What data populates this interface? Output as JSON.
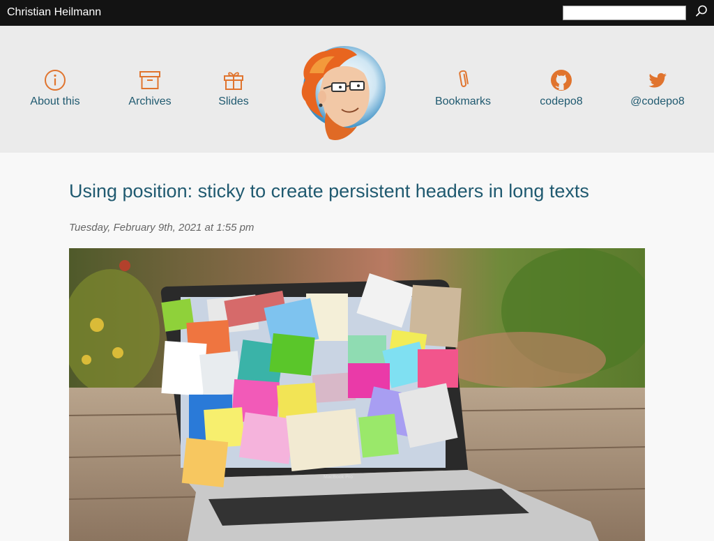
{
  "topbar": {
    "site_title": "Christian Heilmann",
    "search": {
      "value": "",
      "placeholder": ""
    }
  },
  "nav": {
    "left": [
      {
        "label": "About this",
        "icon": "info-icon"
      },
      {
        "label": "Archives",
        "icon": "archive-box-icon"
      },
      {
        "label": "Slides",
        "icon": "gift-icon"
      }
    ],
    "right": [
      {
        "label": "Bookmarks",
        "icon": "paperclip-icon"
      },
      {
        "label": "codepo8",
        "icon": "github-icon"
      },
      {
        "label": "@codepo8",
        "icon": "twitter-icon"
      }
    ]
  },
  "post": {
    "title": "Using position: sticky to create persistent headers in long texts",
    "date": "Tuesday, February 9th, 2021 at 1:55 pm",
    "hero_laptop_brand": "MacBook Pro"
  },
  "colors": {
    "topbar_bg": "#131313",
    "header_bg": "#ebebeb",
    "link": "#205a70",
    "icon_accent": "#e0742e"
  }
}
